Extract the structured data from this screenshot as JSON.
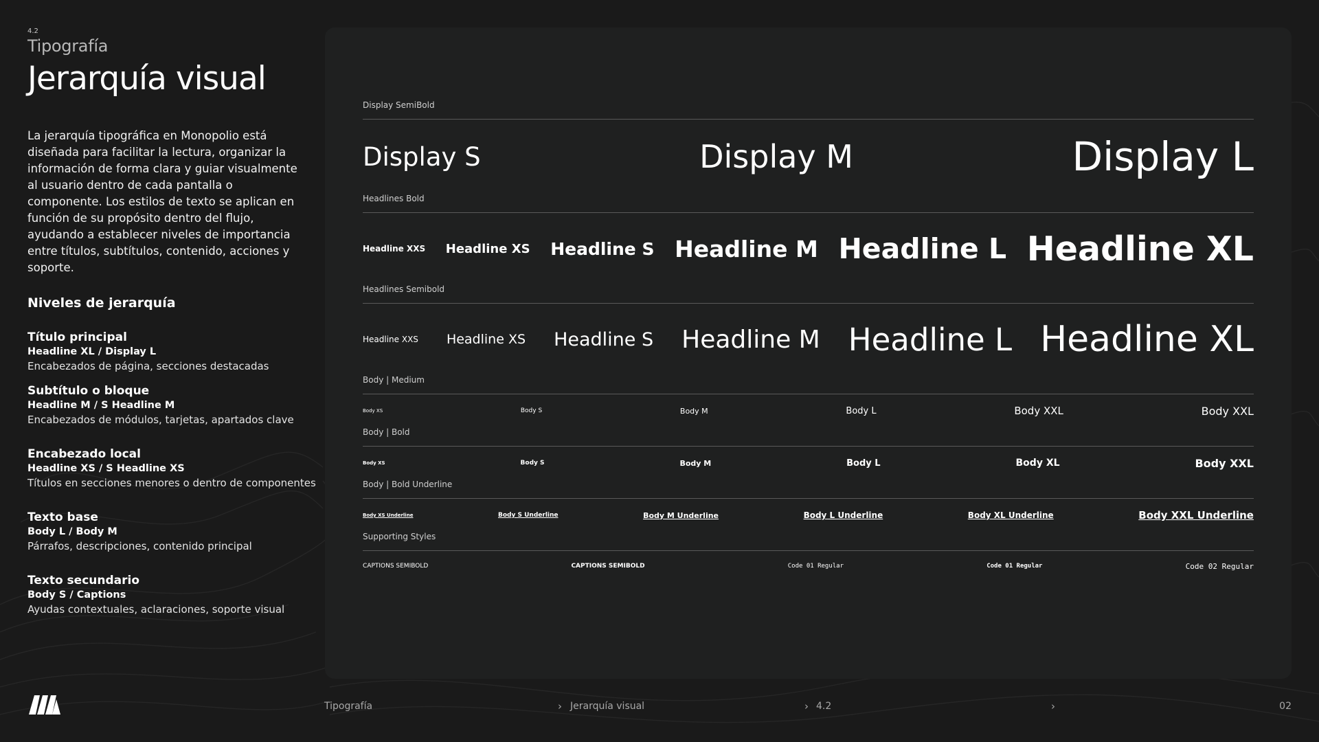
{
  "header": {
    "section_number": "4.2",
    "section_name": "Tipografía",
    "title": "Jerarquía visual"
  },
  "intro": "La jerarquía tipográfica en Monopolio está diseñada para facilitar la lectura, organizar la información de forma clara y guiar visualmente al usuario dentro de cada pantalla o componente. Los estilos de texto se aplican en función de su propósito dentro del flujo, ayudando a establecer niveles de importancia entre títulos, subtítulos, contenido, acciones y soporte.",
  "levels": {
    "title": "Niveles de jerarquía",
    "items": [
      {
        "title": "Título principal",
        "styles": "Headline XL / Display L",
        "desc": "Encabezados de página, secciones destacadas"
      },
      {
        "title": "Subtítulo o bloque",
        "styles": "Headline M / S Headline M",
        "desc": "Encabezados de módulos, tarjetas, apartados clave"
      },
      {
        "title": "Encabezado local",
        "styles": "Headline XS / S Headline XS",
        "desc": "Títulos en secciones menores o dentro de componentes"
      },
      {
        "title": "Texto base",
        "styles": "Body L / Body M",
        "desc": "Párrafos, descripciones, contenido principal"
      },
      {
        "title": "Texto secundario",
        "styles": "Body S / Captions",
        "desc": "Ayudas contextuales, aclaraciones, soporte visual"
      }
    ]
  },
  "specimens": {
    "display": {
      "label": "Display SemiBold",
      "items": [
        "Display S",
        "Display M",
        "Display L"
      ]
    },
    "headlines_bold": {
      "label": "Headlines Bold",
      "items": [
        "Headline XXS",
        "Headline XS",
        "Headline S",
        "Headline M",
        "Headline L",
        "Headline XL"
      ]
    },
    "headlines_semibold": {
      "label": "Headlines Semibold",
      "items": [
        "Headline XXS",
        "Headline XS",
        "Headline S",
        "Headline M",
        "Headline L",
        "Headline XL"
      ]
    },
    "body_medium": {
      "label": "Body | Medium",
      "items": [
        "Body XS",
        "Body S",
        "Body M",
        "Body L",
        "Body XXL",
        "Body XXL"
      ]
    },
    "body_bold": {
      "label": "Body | Bold",
      "items": [
        "Body XS",
        "Body S",
        "Body M",
        "Body L",
        "Body XL",
        "Body XXL"
      ]
    },
    "body_bold_underline": {
      "label": "Body | Bold Underline",
      "items": [
        "Body XS Underline",
        "Body S Underline",
        "Body M Underline",
        "Body L Underline",
        "Body XL Underline",
        "Body XXL Underline"
      ]
    },
    "supporting": {
      "label": "Supporting Styles",
      "items": [
        "CAPTIONS SEMIBOLD",
        "CAPTIONS SEMIBOLD",
        "Code 01 Regular",
        "Code 01 Regular",
        "Code 02 Regular"
      ]
    }
  },
  "footer": {
    "logo_icon": "monopolio-logo-icon",
    "crumb_1": "Tipografía",
    "crumb_2": "Jerarquía visual",
    "crumb_3": "4.2",
    "page_number": "02"
  },
  "colors": {
    "background": "#1a1a1a",
    "panel": "#1f2020",
    "text": "#ffffff",
    "divider": "#5a5a5a"
  }
}
